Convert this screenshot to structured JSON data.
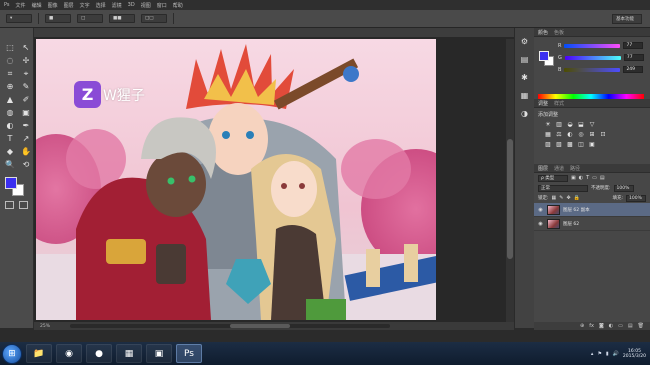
{
  "menubar": [
    "Ps",
    "文件",
    "编辑",
    "图像",
    "图层",
    "文字",
    "选择",
    "滤镜",
    "3D",
    "视图",
    "窗口",
    "帮助"
  ],
  "options": {
    "chips": [
      "▾",
      "■",
      "□",
      "■■",
      "□□"
    ],
    "workspace": "基本功能"
  },
  "tools": [
    "⬚",
    "↖",
    "◌",
    "✢",
    "⌗",
    "⌖",
    "⊕",
    "✎",
    "▲",
    "✐",
    "◍",
    "▣",
    "◐",
    "✒",
    "T",
    "↗",
    "◆",
    "✋",
    "🔍",
    "⟲"
  ],
  "colors": {
    "foreground": "#3b2ff0",
    "background": "#ffffff",
    "accent_layer": "#5b6a85"
  },
  "watermark": {
    "badge": "Z",
    "text": "W猩子"
  },
  "status": {
    "zoom": "25%"
  },
  "dock_icons": [
    "⚙",
    "▤",
    "✱",
    "▦",
    "◑"
  ],
  "color_panel": {
    "tabs": [
      "颜色",
      "色板"
    ],
    "rows": [
      {
        "label": "R",
        "value": "77"
      },
      {
        "label": "G",
        "value": "77"
      },
      {
        "label": "B",
        "value": "249"
      }
    ]
  },
  "adjust_panel": {
    "tabs": [
      "调整",
      "样式"
    ],
    "title": "添加调整",
    "row1": [
      "☀",
      "▥",
      "◒",
      "⬓",
      "▽"
    ],
    "row2": [
      "▦",
      "⚖",
      "◐",
      "◎",
      "⊞",
      "⊡"
    ],
    "row3": [
      "▨",
      "▧",
      "▩",
      "◫",
      "▣"
    ]
  },
  "layers_panel": {
    "tabs": [
      "图层",
      "通道",
      "路径"
    ],
    "filter_label": "ρ 类型",
    "blend_mode": "正常",
    "opacity_label": "不透明度:",
    "opacity_value": "100%",
    "lock_label": "锁定:",
    "fill_label": "填充:",
    "fill_value": "100%",
    "layers": [
      {
        "name": "图层 62 副本",
        "active": true
      },
      {
        "name": "图层 62",
        "active": false
      }
    ],
    "footer_icons": [
      "⊕",
      "fx",
      "◙",
      "◐",
      "▭",
      "▤",
      "🗑"
    ]
  },
  "taskbar": {
    "start": "⊞",
    "apps": [
      "📁",
      "◉",
      "●",
      "▦",
      "▣",
      "Ps"
    ],
    "tray_icons": [
      "▴",
      "⚑",
      "▮",
      "🔊"
    ],
    "time": "16:05",
    "date": "2015/3/20"
  }
}
